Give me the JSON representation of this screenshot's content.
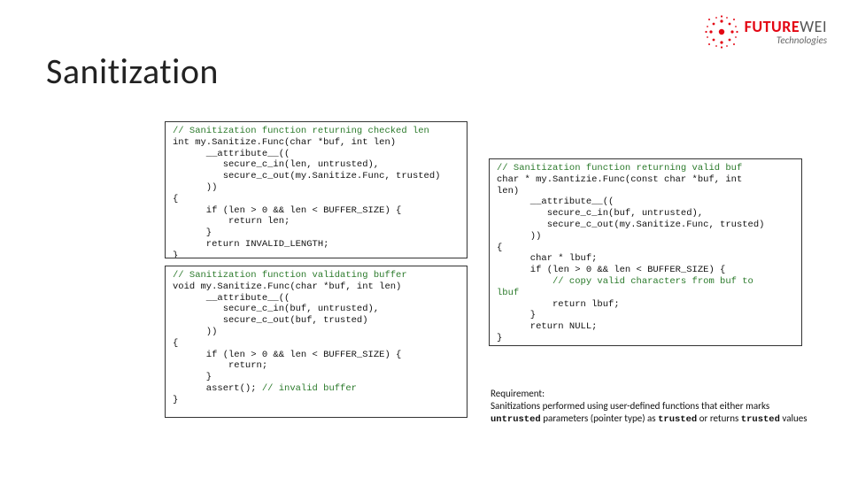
{
  "logo": {
    "brand_bold": "FUTURE",
    "brand_rest": "WEI",
    "subline": "Technologies"
  },
  "title": "Sanitization",
  "code1": {
    "c1": "// Sanitization function returning checked len",
    "l2": "int my.Sanitize.Func(char *buf, int len)",
    "l3": "      __attribute__((",
    "l4": "         secure_c_in(len, untrusted),",
    "l5": "         secure_c_out(my.Sanitize.Func, trusted)",
    "l6": "      ))",
    "l7": "{",
    "l8": "      if (len > 0 && len < BUFFER_SIZE) {",
    "l9": "          return len;",
    "l10": "      }",
    "l11": "      return INVALID_LENGTH;",
    "l12": "}"
  },
  "code2": {
    "c1": "// Sanitization function validating buffer",
    "l2": "void my.Sanitize.Func(char *buf, int len)",
    "l3": "      __attribute__((",
    "l4": "         secure_c_in(buf, untrusted),",
    "l5": "         secure_c_out(buf, trusted)",
    "l6": "      ))",
    "l7": "{",
    "l8": "      if (len > 0 && len < BUFFER_SIZE) {",
    "l9": "          return;",
    "l10": "      }",
    "l11a": "      assert(); ",
    "c11b": "// invalid buffer",
    "l12": "}"
  },
  "code3": {
    "c1": "// Sanitization function returning valid buf",
    "l2": "char * my.Santizie.Func(const char *buf, int",
    "l2b": "len)",
    "l3": "      __attribute__((",
    "l4": "         secure_c_in(buf, untrusted),",
    "l5": "         secure_c_out(my.Sanitize.Func, trusted)",
    "l6": "      ))",
    "l7": "{",
    "l8": "      char * lbuf;",
    "l9": "      if (len > 0 && len < BUFFER_SIZE) {",
    "c10a": "          // copy valid characters from buf to",
    "c10b": "lbuf",
    "l11": "          return lbuf;",
    "l12": "      }",
    "l13": "      return NULL;",
    "l14": "}"
  },
  "requirement": {
    "head": "Requirement:",
    "body1": "Sanitizations performed using user-defined functions that either marks ",
    "kw1": "untrusted",
    "body2": " parameters (pointer type) as ",
    "kw2": "trusted",
    "body3": " or returns ",
    "kw3": "trusted",
    "body4": " values"
  }
}
